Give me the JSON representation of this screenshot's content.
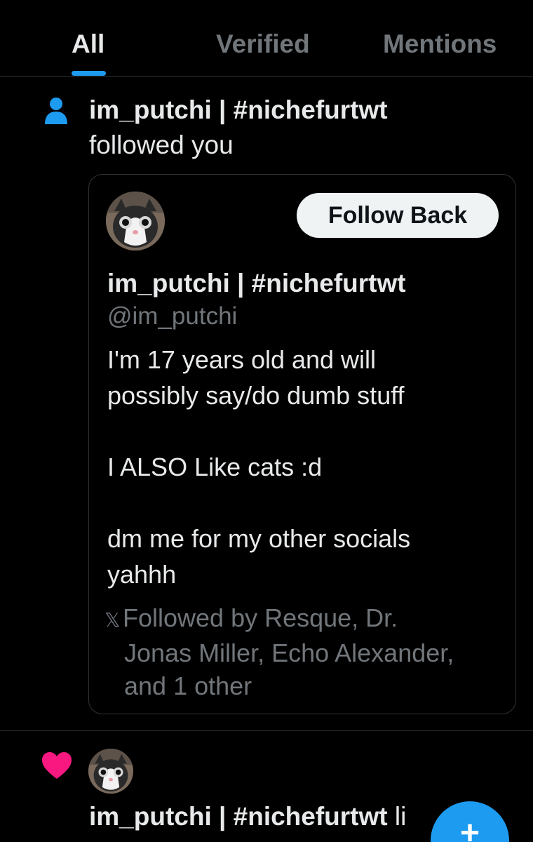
{
  "tabs": [
    {
      "label": "All"
    },
    {
      "label": "Verified"
    },
    {
      "label": "Mentions"
    }
  ],
  "follow_notification": {
    "icon": "person-icon",
    "display_name": "im_putchi | #nichefurtwt",
    "action": "followed you",
    "card": {
      "follow_button": "Follow Back",
      "display_name": "im_putchi | #nichefurtwt",
      "handle": "@im_putchi",
      "bio_lines": [
        "I'm 17 years old and will",
        "possibly say/do dumb stuff",
        "I ALSO Like cats :d",
        "dm me for my other socials",
        "yahhh"
      ],
      "followed_by_lines": [
        "Followed by Resque, Dr.",
        "Jonas Miller, Echo Alexander,",
        "and 1 other"
      ]
    }
  },
  "like_notification": {
    "icon": "heart-icon",
    "display_name": "im_putchi | #nichefurtwt",
    "action_fragment": "li"
  },
  "fab": {
    "icon": "plus-icon",
    "label": "+"
  },
  "colors": {
    "accent": "#1d9bf0",
    "like": "#f91880",
    "muted_text": "#71767b",
    "divider": "#2f3336"
  }
}
